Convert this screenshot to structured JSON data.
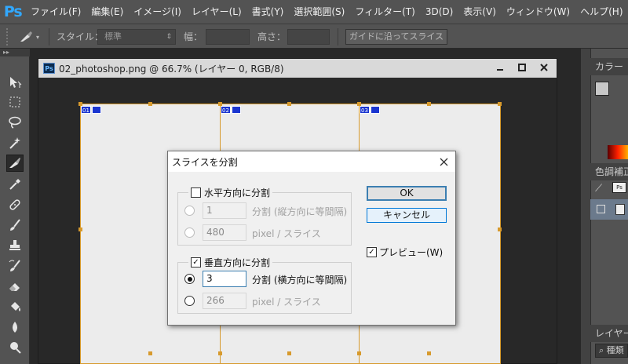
{
  "app": {
    "logo": "Ps"
  },
  "menu": [
    "ファイル(F)",
    "編集(E)",
    "イメージ(I)",
    "レイヤー(L)",
    "書式(Y)",
    "選択範囲(S)",
    "フィルター(T)",
    "3D(D)",
    "表示(V)",
    "ウィンドウ(W)",
    "ヘルプ(H)"
  ],
  "options_bar": {
    "style_label": "スタイル：",
    "style_value": "標準",
    "width_label": "幅：",
    "height_label": "高さ：",
    "guide_button": "ガイドに沿ってスライス"
  },
  "document": {
    "title": "02_photoshop.png @ 66.7% (レイヤー 0, RGB/8)",
    "icon": "Ps",
    "slices": [
      "01",
      "02",
      "03"
    ]
  },
  "panels": {
    "color_tab": "カラー",
    "adjust_tab": "色調補正",
    "layers_tab": "レイヤー",
    "layers_search_label": "種類"
  },
  "dialog": {
    "title": "スライスを分割",
    "horizontal": {
      "label": "水平方向に分割",
      "checked": false,
      "count_value": "1",
      "count_label": "分割 (縦方向に等間隔)",
      "pixel_value": "480",
      "pixel_label": "pixel / スライス"
    },
    "vertical": {
      "label": "垂直方向に分割",
      "checked": true,
      "count_value": "3",
      "count_label": "分割 (横方向に等間隔)",
      "pixel_value": "266",
      "pixel_label": "pixel / スライス"
    },
    "ok_button": "OK",
    "cancel_button": "キャンセル",
    "preview_label": "プレビュー(W)",
    "preview_checked": true
  }
}
